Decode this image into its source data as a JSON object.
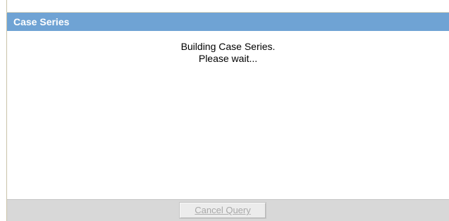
{
  "dialog": {
    "title": "Case Series",
    "message_line1": "Building Case Series.",
    "message_line2": "Please wait..."
  },
  "footer": {
    "cancel_label": "Cancel Query",
    "cancel_disabled": true
  },
  "colors": {
    "title_bar": "#6fa3d4",
    "footer": "#d8d8d8"
  }
}
